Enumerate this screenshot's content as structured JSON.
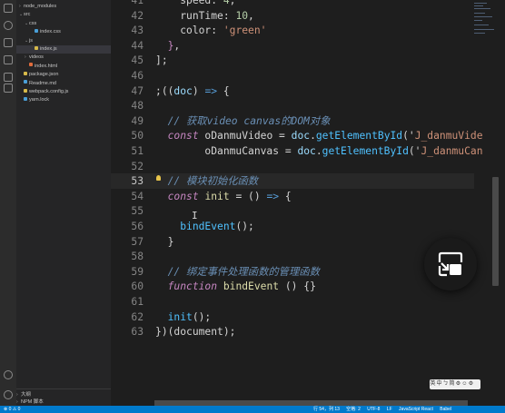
{
  "sidebar": {
    "items": [
      {
        "label": "node_modules",
        "indent": 0,
        "kind": "folder",
        "chevron": ">",
        "color": "#8a8a8a"
      },
      {
        "label": "src",
        "indent": 0,
        "kind": "folder",
        "chevron": "v",
        "color": "#8a8a8a"
      },
      {
        "label": "css",
        "indent": 1,
        "kind": "folder",
        "chevron": "v",
        "color": "#8a8a8a"
      },
      {
        "label": "index.css",
        "indent": 2,
        "kind": "file",
        "chevron": "",
        "color": "#4a9fd8"
      },
      {
        "label": "js",
        "indent": 1,
        "kind": "folder",
        "chevron": "v",
        "color": "#8a8a8a"
      },
      {
        "label": "index.js",
        "indent": 2,
        "kind": "file",
        "chevron": "",
        "color": "#d7ba4a",
        "selected": true
      },
      {
        "label": "videos",
        "indent": 1,
        "kind": "folder",
        "chevron": ">",
        "color": "#8a8a8a"
      },
      {
        "label": "index.html",
        "indent": 1,
        "kind": "file",
        "chevron": "",
        "color": "#e06c3c"
      },
      {
        "label": "package.json",
        "indent": 0,
        "kind": "file",
        "chevron": "",
        "color": "#d7ba4a"
      },
      {
        "label": "Readme.md",
        "indent": 0,
        "kind": "file",
        "chevron": "",
        "color": "#4a9fd8"
      },
      {
        "label": "webpack.config.js",
        "indent": 0,
        "kind": "file",
        "chevron": "",
        "color": "#d7ba4a"
      },
      {
        "label": "yarn.lock",
        "indent": 0,
        "kind": "file",
        "chevron": "",
        "color": "#4a9fd8"
      }
    ],
    "outline_sections": [
      "大纲",
      "NPM 脚本"
    ]
  },
  "editor": {
    "active_line": 53,
    "lines": [
      {
        "n": "41",
        "tokens": [
          [
            "    ",
            "pn"
          ],
          [
            "speed",
            "pn"
          ],
          [
            ": ",
            "pn"
          ],
          [
            "4",
            "num"
          ],
          [
            ",",
            "pn"
          ]
        ]
      },
      {
        "n": "42",
        "tokens": [
          [
            "    ",
            "pn"
          ],
          [
            "runTime",
            "pn"
          ],
          [
            ": ",
            "pn"
          ],
          [
            "10",
            "num"
          ],
          [
            ",",
            "pn"
          ]
        ]
      },
      {
        "n": "43",
        "tokens": [
          [
            "    ",
            "pn"
          ],
          [
            "color",
            "pn"
          ],
          [
            ": ",
            "pn"
          ],
          [
            "'green'",
            "str"
          ]
        ]
      },
      {
        "n": "44",
        "tokens": [
          [
            "  ",
            "pn"
          ],
          [
            "}",
            "br"
          ],
          [
            ",",
            "pn"
          ]
        ]
      },
      {
        "n": "45",
        "tokens": [
          [
            "]",
            "pn"
          ],
          [
            ";",
            "pn"
          ]
        ]
      },
      {
        "n": "46",
        "tokens": []
      },
      {
        "n": "47",
        "tokens": [
          [
            ";",
            "pn"
          ],
          [
            "((",
            "pn"
          ],
          [
            "doc",
            "var"
          ],
          [
            ") ",
            "pn"
          ],
          [
            "=>",
            "kwb"
          ],
          [
            " {",
            "pn"
          ]
        ]
      },
      {
        "n": "48",
        "tokens": []
      },
      {
        "n": "49",
        "tokens": [
          [
            "  ",
            "pn"
          ],
          [
            "// 获取video canvas的DOM对象",
            "cm"
          ]
        ]
      },
      {
        "n": "50",
        "tokens": [
          [
            "  ",
            "pn"
          ],
          [
            "const",
            "kw"
          ],
          [
            " oDanmuVideo = ",
            "pn"
          ],
          [
            "doc",
            "var"
          ],
          [
            ".",
            "pn"
          ],
          [
            "getElementById",
            "fn"
          ],
          [
            "('",
            "pn"
          ],
          [
            "J_danmuVide",
            "str"
          ]
        ]
      },
      {
        "n": "51",
        "tokens": [
          [
            "        oDanmuCanvas = ",
            "pn"
          ],
          [
            "doc",
            "var"
          ],
          [
            ".",
            "pn"
          ],
          [
            "getElementById",
            "fn"
          ],
          [
            "('",
            "pn"
          ],
          [
            "J_danmuCan",
            "str"
          ]
        ]
      },
      {
        "n": "52",
        "tokens": []
      },
      {
        "n": "53",
        "tokens": [
          [
            "  ",
            "pn"
          ],
          [
            "// 模块初始化函数",
            "cm"
          ]
        ]
      },
      {
        "n": "54",
        "tokens": [
          [
            "  ",
            "pn"
          ],
          [
            "const",
            "kw"
          ],
          [
            " ",
            "pn"
          ],
          [
            "init",
            "fnc"
          ],
          [
            " = () ",
            "pn"
          ],
          [
            "=>",
            "kwb"
          ],
          [
            " {",
            "pn"
          ]
        ]
      },
      {
        "n": "55",
        "tokens": []
      },
      {
        "n": "56",
        "tokens": [
          [
            "    ",
            "pn"
          ],
          [
            "bindEvent",
            "fn"
          ],
          [
            "();",
            "pn"
          ]
        ]
      },
      {
        "n": "57",
        "tokens": [
          [
            "  ",
            "pn"
          ],
          [
            "}",
            "pn"
          ]
        ]
      },
      {
        "n": "58",
        "tokens": []
      },
      {
        "n": "59",
        "tokens": [
          [
            "  ",
            "pn"
          ],
          [
            "// 绑定事件处理函数的管理函数",
            "cm"
          ]
        ]
      },
      {
        "n": "60",
        "tokens": [
          [
            "  ",
            "pn"
          ],
          [
            "function",
            "kw"
          ],
          [
            " ",
            "pn"
          ],
          [
            "bindEvent",
            "fnc"
          ],
          [
            " () {}",
            "pn"
          ]
        ]
      },
      {
        "n": "61",
        "tokens": []
      },
      {
        "n": "62",
        "tokens": [
          [
            "  ",
            "pn"
          ],
          [
            "init",
            "fn"
          ],
          [
            "();",
            "pn"
          ]
        ]
      },
      {
        "n": "63",
        "tokens": [
          [
            "}",
            "pn"
          ],
          [
            ")(",
            "pn"
          ],
          [
            "document",
            "pn"
          ],
          [
            ");",
            "pn"
          ]
        ]
      }
    ]
  },
  "icons": {
    "pip": "picture-in-picture-icon",
    "lightbulb": "lightbulb-icon"
  },
  "mini_toolbar": {
    "items": [
      "英",
      "中",
      "ㄅ",
      "简",
      "⚙",
      "☺",
      "⚙"
    ]
  },
  "statusbar": {
    "left": "⊗ 0  ⚠ 0",
    "right": [
      "行 54，列 13",
      "空格: 2",
      "UTF-8",
      "LF",
      "JavaScript React",
      "Babel"
    ]
  },
  "colors": {
    "accent": "#007acc",
    "editor_bg": "#1e1e1e",
    "sidebar_bg": "#252526"
  }
}
